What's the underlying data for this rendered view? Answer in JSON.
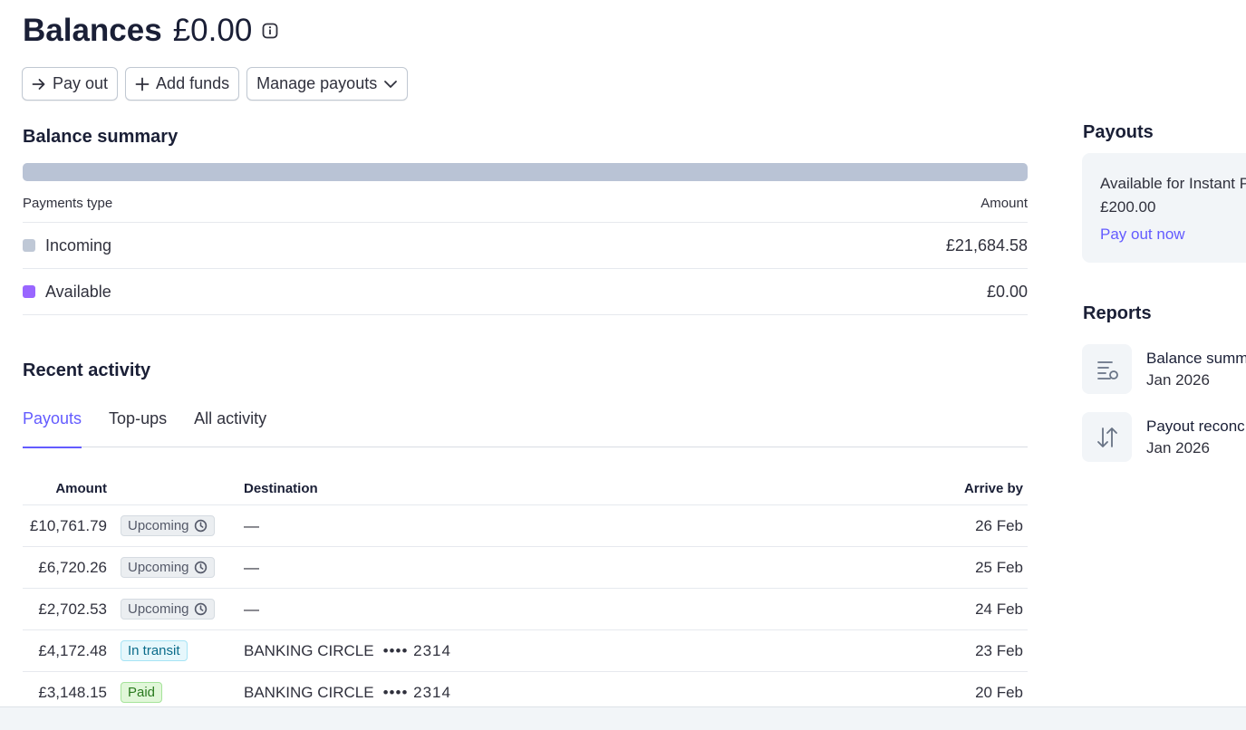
{
  "header": {
    "title": "Balances",
    "amount": "£0.00",
    "info_icon": "info-icon"
  },
  "actions": {
    "pay_out": "Pay out",
    "add_funds": "Add funds",
    "manage_payouts": "Manage payouts"
  },
  "balance_summary": {
    "heading": "Balance summary",
    "col_type": "Payments type",
    "col_amount": "Amount",
    "incoming_share": 1.0,
    "rows": [
      {
        "label": "Incoming",
        "amount": "£21,684.58",
        "color": "#bfc8d6"
      },
      {
        "label": "Available",
        "amount": "£0.00",
        "color": "#9966ff"
      }
    ]
  },
  "recent_activity": {
    "heading": "Recent activity",
    "tabs": [
      "Payouts",
      "Top-ups",
      "All activity"
    ],
    "active_tab": "Payouts",
    "columns": {
      "amount": "Amount",
      "destination": "Destination",
      "arrive_by": "Arrive by"
    },
    "rows": [
      {
        "amount": "£10,761.79",
        "status": "Upcoming",
        "destination": "—",
        "account": "",
        "arrive": "26 Feb"
      },
      {
        "amount": "£6,720.26",
        "status": "Upcoming",
        "destination": "—",
        "account": "",
        "arrive": "25 Feb"
      },
      {
        "amount": "£2,702.53",
        "status": "Upcoming",
        "destination": "—",
        "account": "",
        "arrive": "24 Feb"
      },
      {
        "amount": "£4,172.48",
        "status": "In transit",
        "destination": "BANKING CIRCLE",
        "account": "•••• 2314",
        "arrive": "23 Feb"
      },
      {
        "amount": "£3,148.15",
        "status": "Paid",
        "destination": "BANKING CIRCLE",
        "account": "•••• 2314",
        "arrive": "20 Feb"
      }
    ]
  },
  "sidebar": {
    "payouts_heading": "Payouts",
    "available_label": "Available for Instant P",
    "available_amount": "£200.00",
    "pay_out_now": "Pay out now",
    "reports_heading": "Reports",
    "reports": [
      {
        "name": "Balance summ",
        "date": "Jan 2026",
        "icon": "report-list-icon"
      },
      {
        "name": "Payout reconc",
        "date": "Jan 2026",
        "icon": "swap-arrows-icon"
      }
    ]
  },
  "colors": {
    "accent": "#635bff",
    "incoming": "#bfc8d6",
    "available": "#9966ff"
  }
}
